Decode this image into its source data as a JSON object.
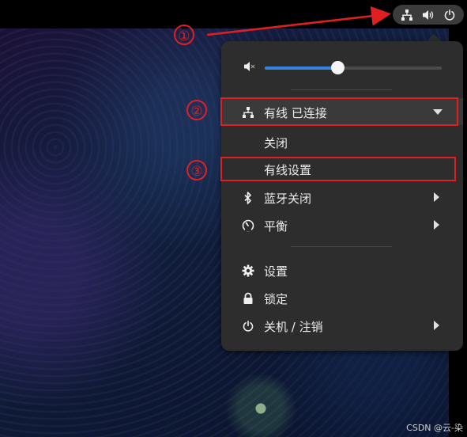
{
  "tray": {
    "icons": [
      "network-wired-icon",
      "volume-icon",
      "power-icon"
    ]
  },
  "annotations": {
    "one": "①",
    "two": "②",
    "three": "③",
    "color": "#e02020"
  },
  "menu": {
    "volume": {
      "icon": "volume-muted-icon",
      "level": 0.41
    },
    "wired": {
      "label": "有线 已连接",
      "icon": "network-wired-icon"
    },
    "wired_off": {
      "label": "关闭"
    },
    "wired_settings": {
      "label": "有线设置"
    },
    "bluetooth": {
      "label": "蓝牙关闭",
      "icon": "bluetooth-icon"
    },
    "power_mode": {
      "label": "平衡",
      "icon": "gauge-icon"
    },
    "settings": {
      "label": "设置",
      "icon": "gear-icon"
    },
    "lock": {
      "label": "锁定",
      "icon": "lock-icon"
    },
    "shutdown": {
      "label": "关机 / 注销",
      "icon": "power-icon"
    }
  },
  "watermark": "CSDN @云-染",
  "colors": {
    "accent": "#3584e4",
    "menu_bg": "#2d2d2d",
    "annotation": "#e02020"
  }
}
